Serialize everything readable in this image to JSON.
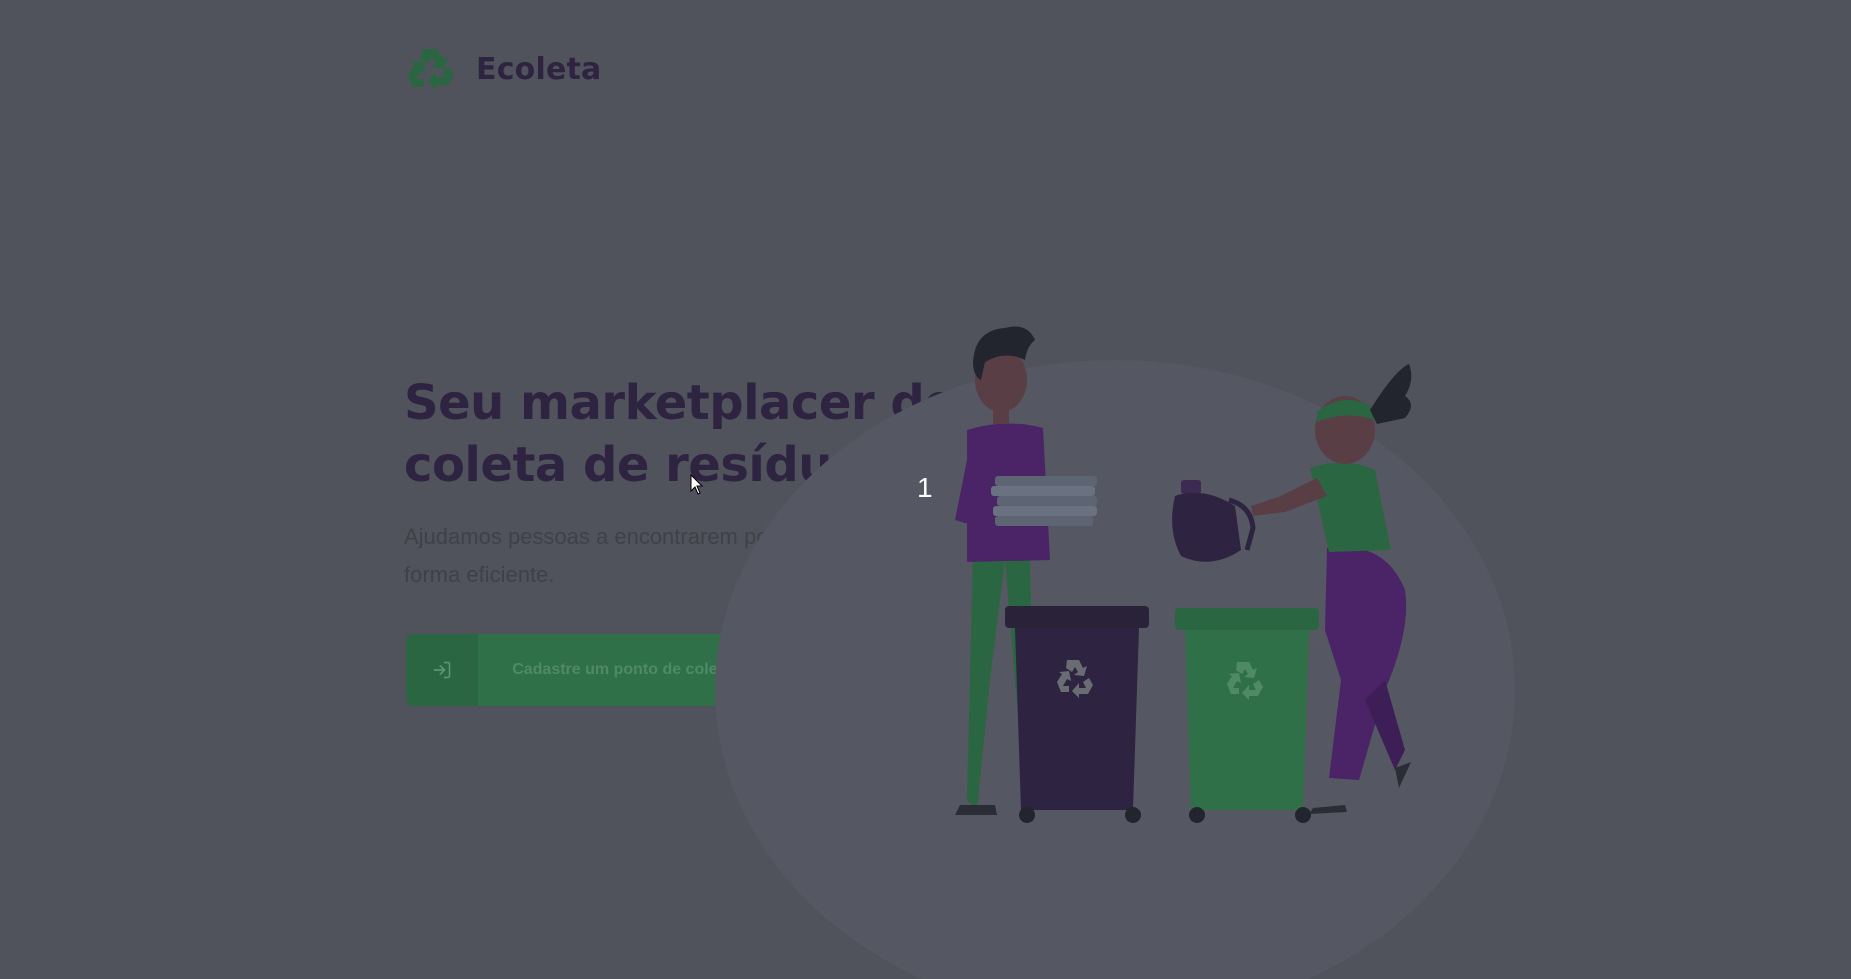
{
  "header": {
    "logo_text": "Ecoleta"
  },
  "hero": {
    "title": "Seu marketplacer de coleta de resíduos.",
    "subtitle": "Ajudamos pessoas a encontrarem pontos de coleta de forma eficiente."
  },
  "cta": {
    "label": "Cadastre um ponto de coleta",
    "icon": "log-in-icon"
  },
  "overlay": {
    "step_number": "1"
  },
  "colors": {
    "background": "#50535c",
    "heading": "#2e2340",
    "brand_green": "#2f7049",
    "brand_purple": "#2e2340"
  }
}
